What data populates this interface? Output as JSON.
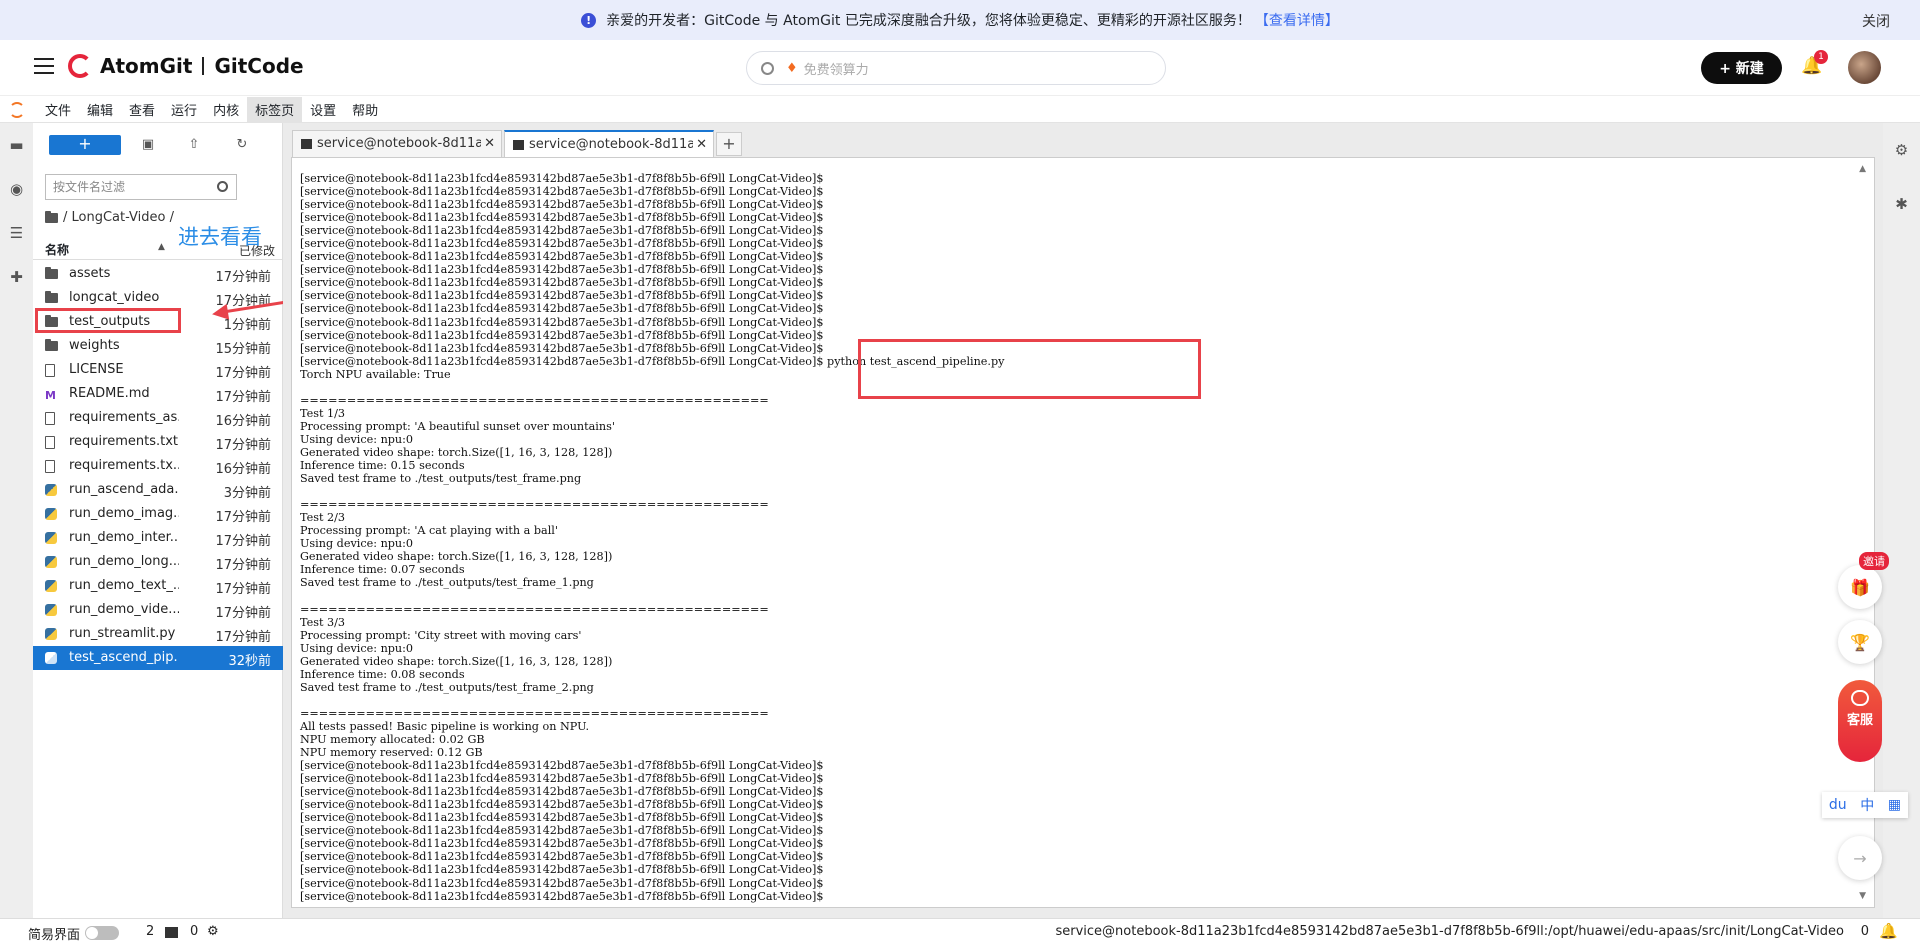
{
  "banner": {
    "message": "亲爱的开发者：GitCode 与 AtomGit 已完成深度融合升级，您将体验更稳定、更精彩的开源社区服务！",
    "link": "【查看详情】",
    "close": "关闭"
  },
  "header": {
    "brand_left": "AtomGit",
    "brand_right": "GitCode",
    "search_placeholder": "免费领算力",
    "new_button": "+ 新建",
    "notification_count": "1"
  },
  "menubar": {
    "items": [
      "文件",
      "编辑",
      "查看",
      "运行",
      "内核",
      "标签页",
      "设置",
      "帮助"
    ]
  },
  "file_browser": {
    "new_label": "+",
    "filter_placeholder": "按文件名过滤",
    "breadcrumb": "/ LongCat-Video /",
    "col_name": "名称",
    "col_modified": "已修改",
    "files": [
      {
        "name": "assets",
        "type": "folder",
        "time": "17分钟前"
      },
      {
        "name": "longcat_video",
        "type": "folder",
        "time": "17分钟前"
      },
      {
        "name": "test_outputs",
        "type": "folder",
        "time": "1分钟前"
      },
      {
        "name": "weights",
        "type": "folder",
        "time": "15分钟前"
      },
      {
        "name": "LICENSE",
        "type": "file",
        "time": "17分钟前"
      },
      {
        "name": "README.md",
        "type": "md",
        "time": "17分钟前"
      },
      {
        "name": "requirements_as...",
        "type": "file",
        "time": "16分钟前"
      },
      {
        "name": "requirements.txt",
        "type": "file",
        "time": "17分钟前"
      },
      {
        "name": "requirements.tx...",
        "type": "file",
        "time": "16分钟前"
      },
      {
        "name": "run_ascend_ada...",
        "type": "py",
        "time": "3分钟前"
      },
      {
        "name": "run_demo_imag...",
        "type": "py",
        "time": "17分钟前"
      },
      {
        "name": "run_demo_inter...",
        "type": "py",
        "time": "17分钟前"
      },
      {
        "name": "run_demo_long...",
        "type": "py",
        "time": "17分钟前"
      },
      {
        "name": "run_demo_text_...",
        "type": "py",
        "time": "17分钟前"
      },
      {
        "name": "run_demo_vide...",
        "type": "py",
        "time": "17分钟前"
      },
      {
        "name": "run_streamlit.py",
        "type": "py",
        "time": "17分钟前"
      },
      {
        "name": "test_ascend_pip...",
        "type": "py",
        "time": "32秒前",
        "selected": true
      }
    ]
  },
  "annotation": {
    "text": "进去看看"
  },
  "tabs": [
    {
      "label": "service@notebook-8d11a2"
    },
    {
      "label": "service@notebook-8d11a2",
      "active": true
    }
  ],
  "terminal": {
    "lines": [
      "[service@notebook-8d11a23b1fcd4e8593142bd87ae5e3b1-d7f8f8b5b-6f9ll LongCat-Video]$",
      "[service@notebook-8d11a23b1fcd4e8593142bd87ae5e3b1-d7f8f8b5b-6f9ll LongCat-Video]$",
      "[service@notebook-8d11a23b1fcd4e8593142bd87ae5e3b1-d7f8f8b5b-6f9ll LongCat-Video]$",
      "[service@notebook-8d11a23b1fcd4e8593142bd87ae5e3b1-d7f8f8b5b-6f9ll LongCat-Video]$",
      "[service@notebook-8d11a23b1fcd4e8593142bd87ae5e3b1-d7f8f8b5b-6f9ll LongCat-Video]$",
      "[service@notebook-8d11a23b1fcd4e8593142bd87ae5e3b1-d7f8f8b5b-6f9ll LongCat-Video]$",
      "[service@notebook-8d11a23b1fcd4e8593142bd87ae5e3b1-d7f8f8b5b-6f9ll LongCat-Video]$",
      "[service@notebook-8d11a23b1fcd4e8593142bd87ae5e3b1-d7f8f8b5b-6f9ll LongCat-Video]$",
      "[service@notebook-8d11a23b1fcd4e8593142bd87ae5e3b1-d7f8f8b5b-6f9ll LongCat-Video]$",
      "[service@notebook-8d11a23b1fcd4e8593142bd87ae5e3b1-d7f8f8b5b-6f9ll LongCat-Video]$",
      "[service@notebook-8d11a23b1fcd4e8593142bd87ae5e3b1-d7f8f8b5b-6f9ll LongCat-Video]$",
      "[service@notebook-8d11a23b1fcd4e8593142bd87ae5e3b1-d7f8f8b5b-6f9ll LongCat-Video]$",
      "[service@notebook-8d11a23b1fcd4e8593142bd87ae5e3b1-d7f8f8b5b-6f9ll LongCat-Video]$",
      "[service@notebook-8d11a23b1fcd4e8593142bd87ae5e3b1-d7f8f8b5b-6f9ll LongCat-Video]$",
      "[service@notebook-8d11a23b1fcd4e8593142bd87ae5e3b1-d7f8f8b5b-6f9ll LongCat-Video]$ python test_ascend_pipeline.py",
      "Torch NPU available: True",
      "",
      "==================================================",
      "Test 1/3",
      "Processing prompt: 'A beautiful sunset over mountains'",
      "Using device: npu:0",
      "Generated video shape: torch.Size([1, 16, 3, 128, 128])",
      "Inference time: 0.15 seconds",
      "Saved test frame to ./test_outputs/test_frame.png",
      "",
      "==================================================",
      "Test 2/3",
      "Processing prompt: 'A cat playing with a ball'",
      "Using device: npu:0",
      "Generated video shape: torch.Size([1, 16, 3, 128, 128])",
      "Inference time: 0.07 seconds",
      "Saved test frame to ./test_outputs/test_frame_1.png",
      "",
      "==================================================",
      "Test 3/3",
      "Processing prompt: 'City street with moving cars'",
      "Using device: npu:0",
      "Generated video shape: torch.Size([1, 16, 3, 128, 128])",
      "Inference time: 0.08 seconds",
      "Saved test frame to ./test_outputs/test_frame_2.png",
      "",
      "==================================================",
      "All tests passed! Basic pipeline is working on NPU.",
      "NPU memory allocated: 0.02 GB",
      "NPU memory reserved: 0.12 GB",
      "[service@notebook-8d11a23b1fcd4e8593142bd87ae5e3b1-d7f8f8b5b-6f9ll LongCat-Video]$",
      "[service@notebook-8d11a23b1fcd4e8593142bd87ae5e3b1-d7f8f8b5b-6f9ll LongCat-Video]$",
      "[service@notebook-8d11a23b1fcd4e8593142bd87ae5e3b1-d7f8f8b5b-6f9ll LongCat-Video]$",
      "[service@notebook-8d11a23b1fcd4e8593142bd87ae5e3b1-d7f8f8b5b-6f9ll LongCat-Video]$",
      "[service@notebook-8d11a23b1fcd4e8593142bd87ae5e3b1-d7f8f8b5b-6f9ll LongCat-Video]$",
      "[service@notebook-8d11a23b1fcd4e8593142bd87ae5e3b1-d7f8f8b5b-6f9ll LongCat-Video]$",
      "[service@notebook-8d11a23b1fcd4e8593142bd87ae5e3b1-d7f8f8b5b-6f9ll LongCat-Video]$",
      "[service@notebook-8d11a23b1fcd4e8593142bd87ae5e3b1-d7f8f8b5b-6f9ll LongCat-Video]$",
      "[service@notebook-8d11a23b1fcd4e8593142bd87ae5e3b1-d7f8f8b5b-6f9ll LongCat-Video]$",
      "[service@notebook-8d11a23b1fcd4e8593142bd87ae5e3b1-d7f8f8b5b-6f9ll LongCat-Video]$",
      "[service@notebook-8d11a23b1fcd4e8593142bd87ae5e3b1-d7f8f8b5b-6f9ll LongCat-Video]$"
    ]
  },
  "widgets": {
    "invite": "邀请",
    "service": "客服",
    "ime_lang": "中"
  },
  "statusbar": {
    "simple_mode": "简易界面",
    "kernel_count": "2",
    "terminal_count": "0",
    "path": "service@notebook-8d11a23b1fcd4e8593142bd87ae5e3b1-d7f8f8b5b-6f9ll:/opt/huawei/edu-apaas/src/init/LongCat-Video",
    "right_count": "0"
  },
  "colors": {
    "accent": "#1976d2",
    "annotation_red": "#e8424a",
    "brand_red": "#e5253b"
  }
}
